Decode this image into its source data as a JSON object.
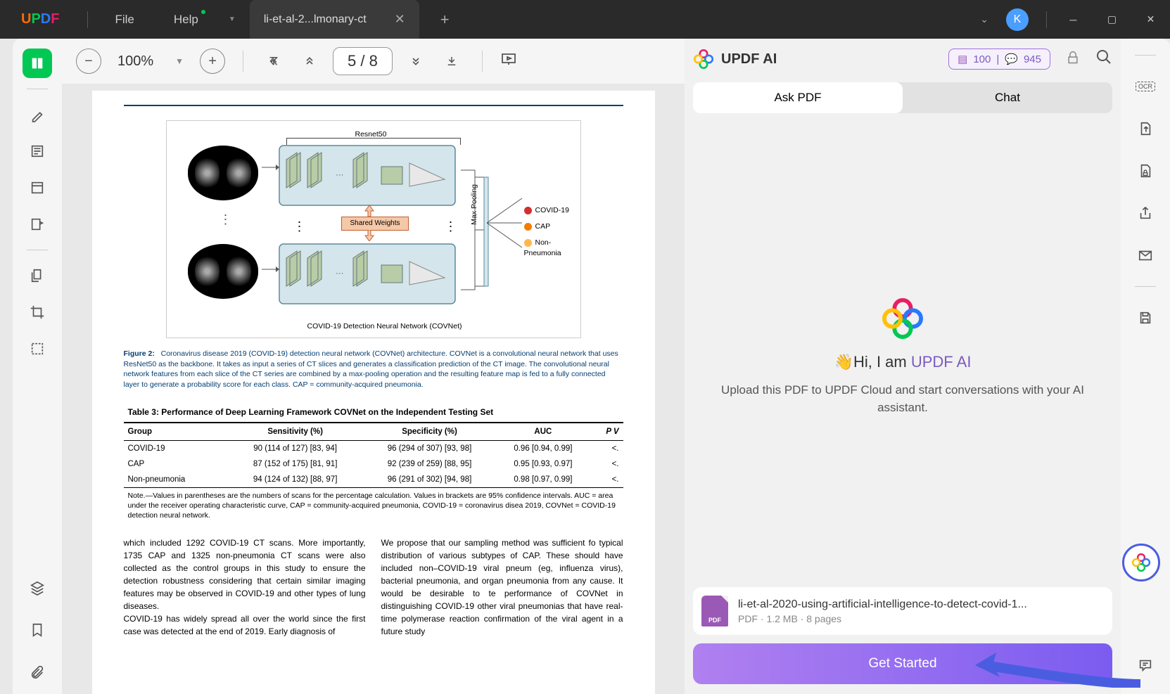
{
  "titlebar": {
    "logo": {
      "u": "U",
      "p": "P",
      "d": "D",
      "f": "F"
    },
    "menu": {
      "file": "File",
      "help": "Help"
    },
    "tab": {
      "title": "li-et-al-2...lmonary-ct"
    },
    "avatar": "K"
  },
  "toolbar": {
    "zoom": "100%",
    "page_current": "5",
    "page_sep": "/",
    "page_total": "8"
  },
  "ai": {
    "title": "UPDF AI",
    "badge": {
      "pages_icon": "▤",
      "pages": "100",
      "sep": "|",
      "prompts_icon": "💬",
      "prompts": "945"
    },
    "tabs": {
      "ask": "Ask PDF",
      "chat": "Chat"
    },
    "greet_prefix": "👋Hi, I am ",
    "greet_brand": "UPDF AI",
    "desc": "Upload this PDF to UPDF Cloud and start conversations with your AI assistant.",
    "file": {
      "icon_label": "PDF",
      "name": "li-et-al-2020-using-artificial-intelligence-to-detect-covid-1...",
      "meta": "PDF · 1.2 MB · 8 pages"
    },
    "get_started": "Get Started"
  },
  "doc": {
    "fig": {
      "resnet_label": "Resnet50",
      "shared": "Shared Weights",
      "maxpool": "Max Pooling",
      "legend": {
        "covid": "COVID-19",
        "cap": "CAP",
        "non": "Non-Pneumonia"
      },
      "covnet": "COVID-19 Detection Neural Network (COVNet)"
    },
    "caption_label": "Figure 2:",
    "caption": "Coronavirus disease 2019 (COVID-19) detection neural network (COVNet) architecture. COVNet is a convolutional neural network that uses ResNet50 as the backbone. It takes as input a series of CT slices and generates a classification prediction of the CT image. The convolutional neural network features from each slice of the CT series are combined by a max-pooling operation and the resulting feature map is fed to a fully connected layer to generate a probability score for each class. CAP = community-acquired pneumonia.",
    "table": {
      "title": "Table 3: Performance of Deep Learning Framework COVNet on the Independent Testing Set",
      "h1": "Group",
      "h2": "Sensitivity (%)",
      "h3": "Specificity (%)",
      "h4": "AUC",
      "h5": "P V",
      "r1c1": "COVID-19",
      "r1c2": "90 (114 of 127) [83, 94]",
      "r1c3": "96 (294 of 307) [93, 98]",
      "r1c4": "0.96 [0.94, 0.99]",
      "r1c5": "<.",
      "r2c1": "CAP",
      "r2c2": "87 (152 of 175) [81, 91]",
      "r2c3": "92 (239 of 259) [88, 95]",
      "r2c4": "0.95 [0.93, 0.97]",
      "r2c5": "<.",
      "r3c1": "Non-pneumonia",
      "r3c2": "94 (124 of 132) [88, 97]",
      "r3c3": "96 (291 of 302) [94, 98]",
      "r3c4": "0.98 [0.97, 0.99]",
      "r3c5": "<.",
      "note": "Note.—Values in parentheses are the numbers of scans for the percentage calculation. Values in brackets are 95% confidence intervals. AUC = area under the receiver operating characteristic curve, CAP = community-acquired pneumonia, COVID-19 = coronavirus disea 2019, COVNet = COVID-19 detection neural network."
    },
    "body": {
      "left": "which included 1292 COVID-19 CT scans. More importantly, 1735 CAP and 1325 non-pneumonia CT scans were also collected as the control groups in this study to ensure the detection robustness considering that certain similar imaging features may be observed in COVID-19 and other types of lung diseases.\n    COVID-19 has widely spread all over the world since the first case was detected at the end of 2019. Early diagnosis of",
      "right": "We propose that our sampling method was sufficient fo typical distribution of various subtypes of CAP. These should have included non–COVID-19 viral pneum (eg, influenza virus), bacterial pneumonia, and organ pneumonia from any cause. It would be desirable to te performance of COVNet in distinguishing COVID-19 other viral pneumonias that have real-time polymerase reaction confirmation of the viral agent in a future study"
    }
  }
}
